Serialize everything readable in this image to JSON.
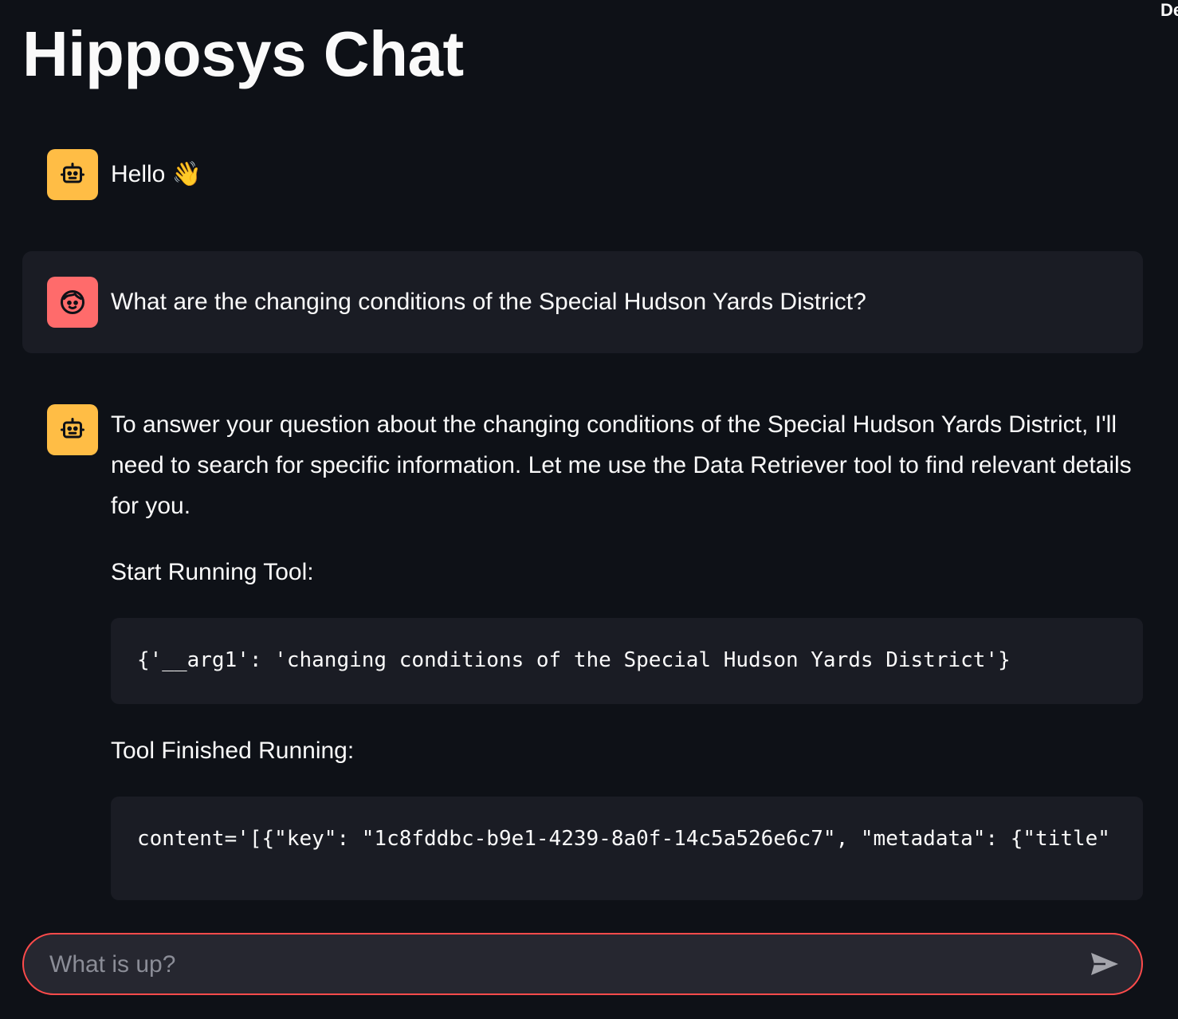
{
  "header": {
    "corner_label": "De",
    "title": "Hipposys Chat"
  },
  "messages": [
    {
      "role": "assistant",
      "avatar_icon": "robot-icon",
      "text": "Hello 👋"
    },
    {
      "role": "user",
      "avatar_icon": "face-icon",
      "text": "What are the changing conditions of the Special Hudson Yards District?"
    },
    {
      "role": "assistant",
      "avatar_icon": "robot-icon",
      "text": "To answer your question about the changing conditions of the Special Hudson Yards District, I'll need to search for specific information. Let me use the Data Retriever tool to find relevant details for you.",
      "tool_start_label": "Start Running Tool:",
      "tool_start_code": "{'__arg1': 'changing conditions of the Special Hudson Yards District'}",
      "tool_finished_label": "Tool Finished Running:",
      "tool_finished_code": "content='[{\"key\": \"1c8fddbc-b9e1-4239-8a0f-14c5a526e6c7\", \"metadata\": {\"title\""
    }
  ],
  "chat_input": {
    "placeholder": "What is up?",
    "value": "",
    "send_icon": "send-icon"
  },
  "colors": {
    "background": "#0e1117",
    "assistant_avatar": "#ffbd45",
    "user_avatar": "#ff6b6b",
    "input_border": "#ff4b4b",
    "surface": "#1a1c24"
  }
}
